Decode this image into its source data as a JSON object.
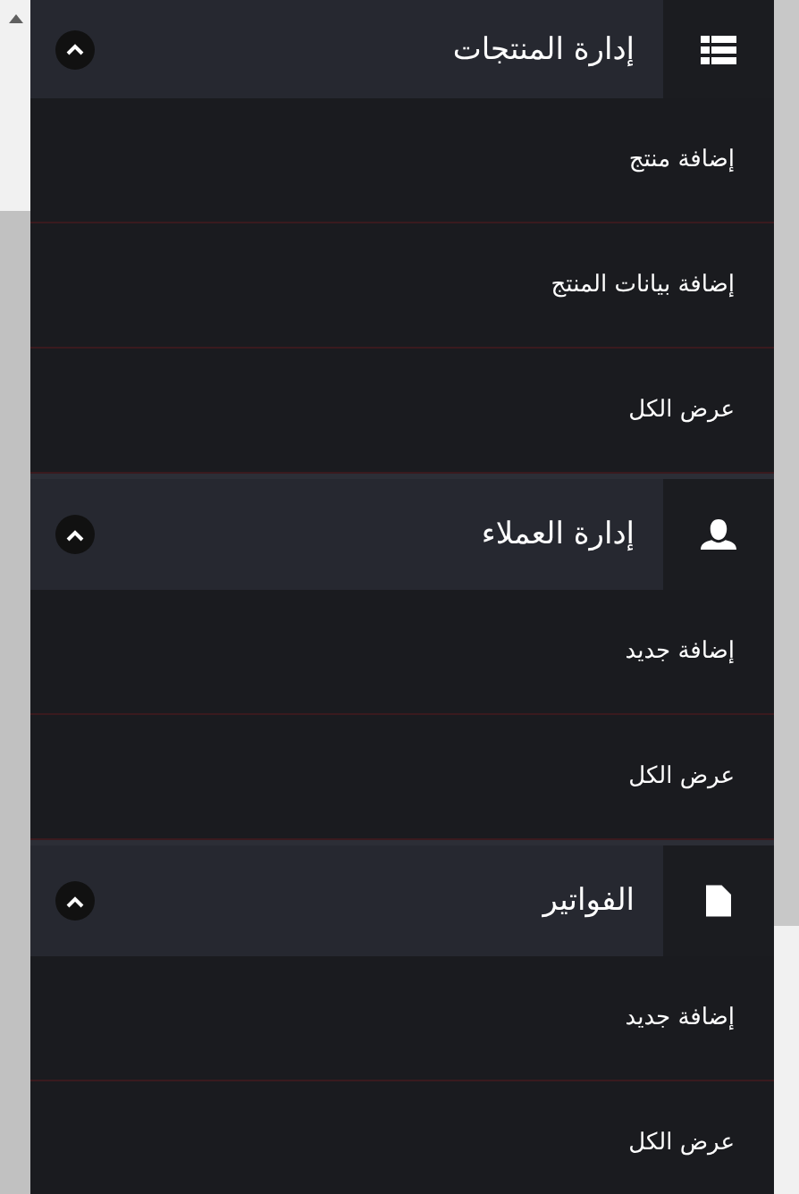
{
  "sections": [
    {
      "title": "إدارة المنتجات",
      "expanded": true,
      "items": [
        "إضافة منتج",
        "إضافة بيانات المنتج",
        "عرض الكل"
      ]
    },
    {
      "title": "إدارة العملاء",
      "expanded": true,
      "items": [
        "إضافة جديد",
        "عرض الكل"
      ]
    },
    {
      "title": "الفواتير",
      "expanded": true,
      "items": [
        "إضافة جديد",
        "عرض الكل"
      ]
    }
  ]
}
